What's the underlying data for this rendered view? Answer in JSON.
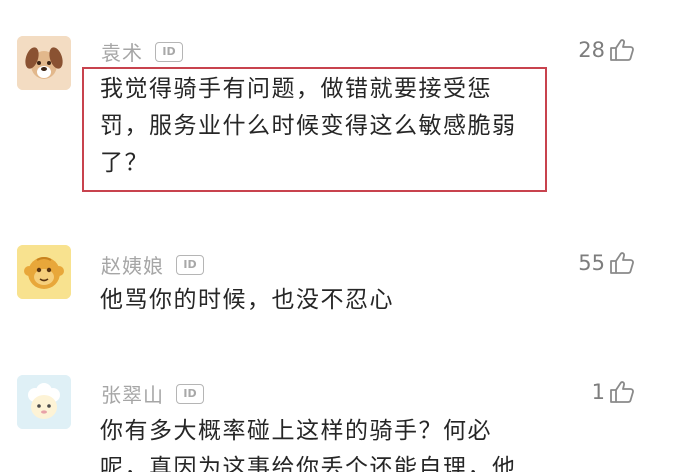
{
  "comments": [
    {
      "username": "袁术",
      "id_badge": "ID",
      "likes": "28",
      "lines": [
        "我觉得骑手有问题，做错就要接受惩",
        "罚，服务业什么时候变得这么敏感脆弱",
        "了？"
      ],
      "avatar_icon": "dog-avatar-icon",
      "avatar_bg": "#f3dcc2"
    },
    {
      "username": "赵姨娘",
      "id_badge": "ID",
      "likes": "55",
      "lines": [
        "他骂你的时候，也没不忍心"
      ],
      "avatar_icon": "monkey-avatar-icon",
      "avatar_bg": "#f8e28f"
    },
    {
      "username": "张翠山",
      "id_badge": "ID",
      "likes": "1",
      "lines": [
        "你有多大概率碰上这样的骑手？何必",
        "呢，真因为这事给你丢个还能自理，他"
      ],
      "avatar_icon": "sheep-avatar-icon",
      "avatar_bg": "#dff0f6"
    }
  ],
  "colors": {
    "username": "#a6a6a6",
    "text": "#262626",
    "likes": "#7d7d7d",
    "highlight": "#c8434e"
  }
}
